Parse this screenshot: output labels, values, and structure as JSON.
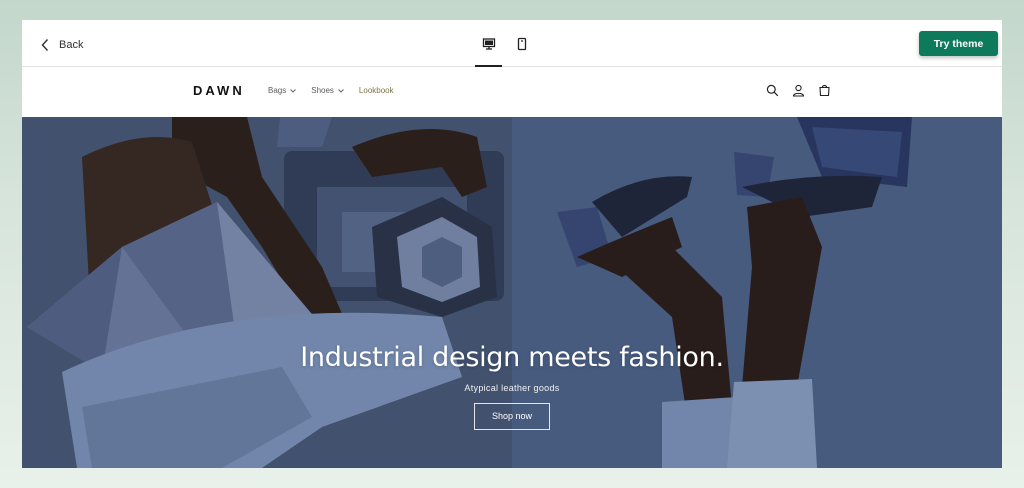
{
  "toolbar": {
    "back_label": "Back",
    "devices": [
      {
        "name": "desktop",
        "active": true
      },
      {
        "name": "mobile",
        "active": false
      }
    ],
    "try_label": "Try theme",
    "accent_color": "#0e7a5c"
  },
  "store": {
    "logo": "DAWN",
    "nav": [
      {
        "label": "Bags",
        "has_dropdown": true
      },
      {
        "label": "Shoes",
        "has_dropdown": true
      },
      {
        "label": "Lookbook",
        "has_dropdown": false
      }
    ],
    "icons": [
      "search-icon",
      "account-icon",
      "cart-icon"
    ]
  },
  "hero": {
    "title": "Industrial design meets fashion.",
    "subtitle": "Atypical leather goods",
    "button_label": "Shop now",
    "image": "model-with-blue-leather-bags-and-heels"
  }
}
